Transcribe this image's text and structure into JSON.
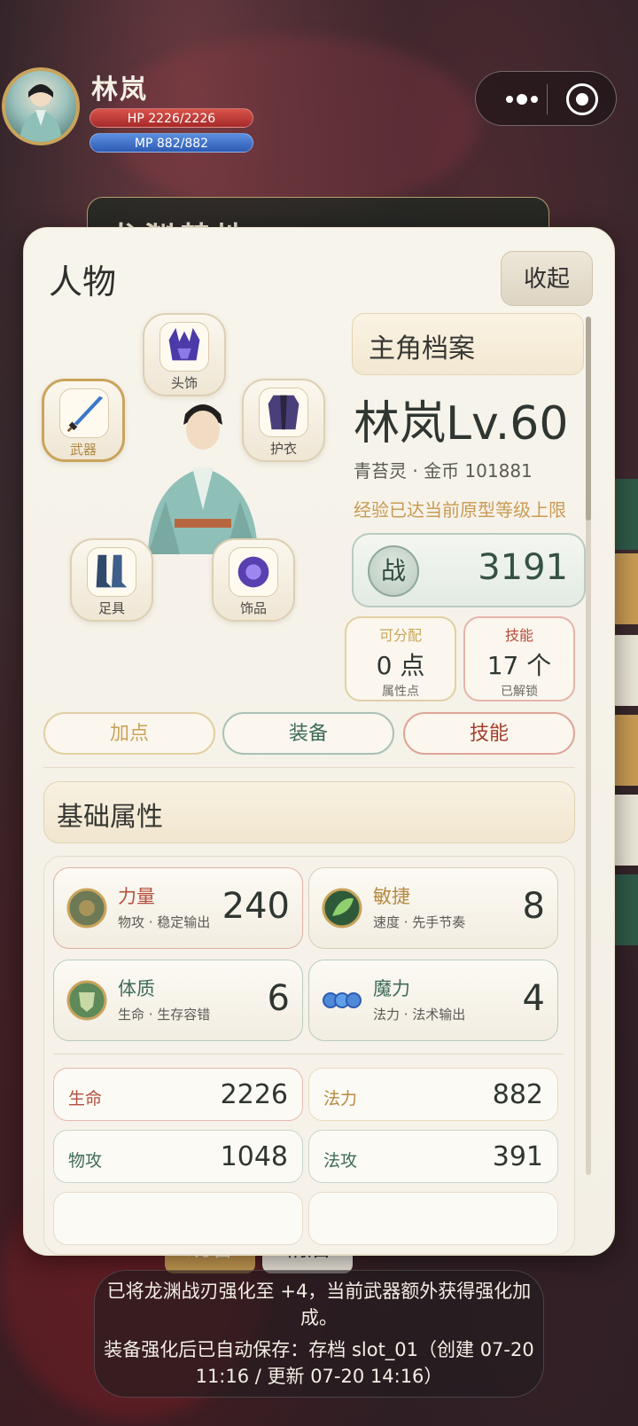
{
  "hud": {
    "player_name": "林岚",
    "hp_text": "HP 2226/2226",
    "mp_text": "MP 882/882"
  },
  "scene": {
    "title": "龙渊禁地"
  },
  "panel": {
    "title": "人物",
    "collapse_label": "收起",
    "equipment": [
      {
        "slot": "头饰",
        "icon": "horned-helmet-icon"
      },
      {
        "slot": "武器",
        "icon": "sword-icon"
      },
      {
        "slot": "护衣",
        "icon": "armor-icon"
      },
      {
        "slot": "足具",
        "icon": "boots-icon"
      },
      {
        "slot": "饰品",
        "icon": "orb-ornament-icon"
      }
    ],
    "profile": {
      "header": "主角档案",
      "name_level": "林岚Lv.60",
      "sub": "青苔灵 · 金币 101881",
      "note": "经验已达当前原型等级上限",
      "power_label": "战",
      "power_value": "3191",
      "points": {
        "title": "可分配",
        "value": "0 点",
        "sub": "属性点"
      },
      "skills": {
        "title": "技能",
        "value": "17 个",
        "sub": "已解锁"
      }
    },
    "tabs": [
      {
        "label": "加点"
      },
      {
        "label": "装备"
      },
      {
        "label": "技能"
      }
    ],
    "base_attr": {
      "header": "基础属性",
      "attrs": [
        {
          "name": "力量",
          "desc": "物攻 · 稳定输出",
          "value": "240",
          "icon": "strength-emblem-icon"
        },
        {
          "name": "敏捷",
          "desc": "速度 · 先手节奏",
          "value": "8",
          "icon": "leaf-emblem-icon"
        },
        {
          "name": "体质",
          "desc": "生命 · 生存容错",
          "value": "6",
          "icon": "shield-emblem-icon"
        },
        {
          "name": "魔力",
          "desc": "法力 · 法术输出",
          "value": "4",
          "icon": "mana-orbs-icon"
        }
      ],
      "values": [
        {
          "name": "生命",
          "value": "2226"
        },
        {
          "name": "法力",
          "value": "882"
        },
        {
          "name": "物攻",
          "value": "1048"
        },
        {
          "name": "法攻",
          "value": "391"
        }
      ]
    }
  },
  "dialog": {
    "watch_label": "观看",
    "later_label": "稍后"
  },
  "toast": {
    "line1": "已将龙渊战刃强化至 +4，当前武器额外获得强化加成。",
    "line2": "装备强化后已自动保存：存档 slot_01（创建 07-20 11:16 / 更新 07-20 14:16）"
  },
  "colors": {
    "accent_gold": "#c9a45c",
    "accent_green": "#3f6b58",
    "accent_red": "#b3503e",
    "hp_red": "#d9534b",
    "mp_blue": "#5c8fe0"
  }
}
